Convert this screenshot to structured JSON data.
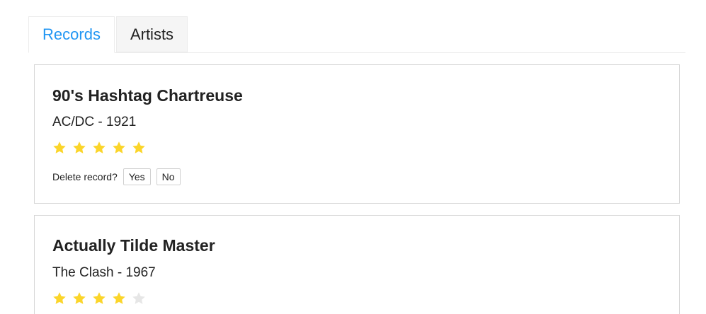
{
  "tabs": [
    {
      "label": "Records",
      "active": true
    },
    {
      "label": "Artists",
      "active": false
    }
  ],
  "colors": {
    "accent": "#2196f3",
    "star_filled": "#fbd52a",
    "star_empty": "#e6e6e6"
  },
  "records": [
    {
      "title": "90's Hashtag Chartreuse",
      "subtitle": "AC/DC - 1921",
      "rating": 5,
      "rating_max": 5,
      "delete_prompt": "Delete record?",
      "yes_label": "Yes",
      "no_label": "No"
    },
    {
      "title": "Actually Tilde Master",
      "subtitle": "The Clash - 1967",
      "rating": 4,
      "rating_max": 5
    }
  ]
}
